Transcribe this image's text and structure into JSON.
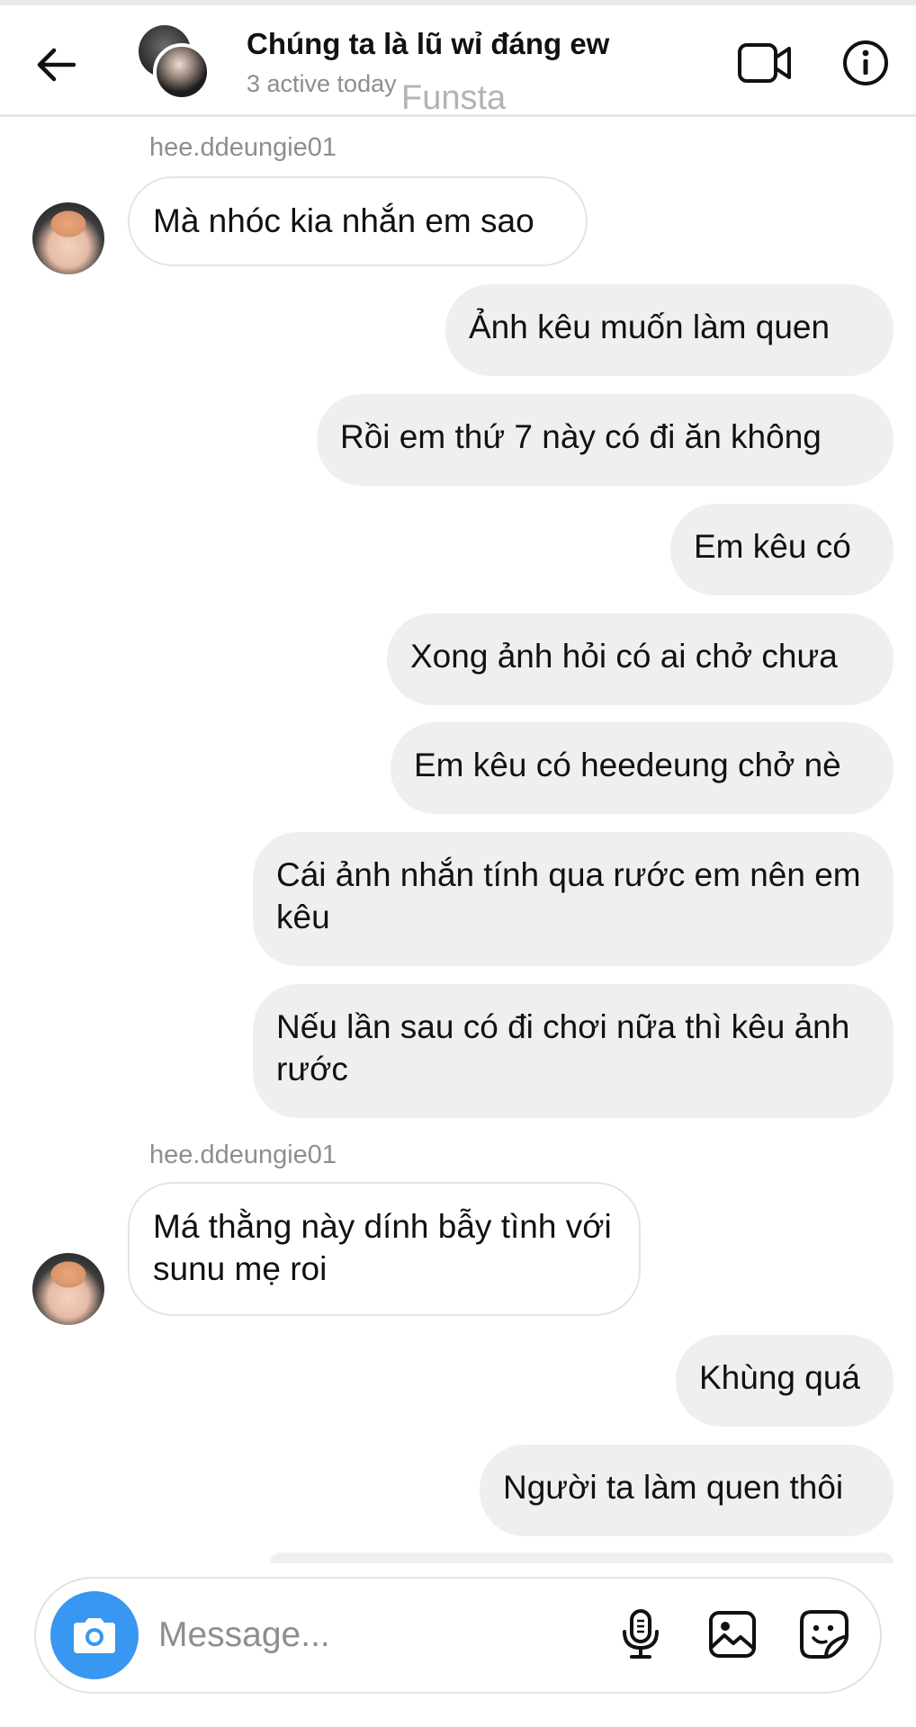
{
  "header": {
    "title": "Chúng ta là lũ wỉ đáng ew",
    "subtitle": "3 active today",
    "watermark": "Funsta"
  },
  "icons": {
    "back": "arrow-left-icon",
    "video": "video-camera-icon",
    "info": "info-icon",
    "camera": "camera-icon",
    "mic": "microphone-icon",
    "gallery": "image-icon",
    "sticker": "sticker-icon"
  },
  "messages": [
    {
      "sender": "hee.ddeungie01",
      "text": "Mà nhóc kia nhắn em sao"
    },
    {
      "text": "Ảnh kêu muốn làm quen"
    },
    {
      "text": "Rồi em thứ 7 này có đi ăn không"
    },
    {
      "text": "Em kêu có"
    },
    {
      "text": "Xong ảnh hỏi có ai chở chưa"
    },
    {
      "text": "Em kêu có heedeung chở nè"
    },
    {
      "text": "Cái ảnh nhắn tính qua rước em nên em kêu"
    },
    {
      "text": "Nếu lần sau có đi chơi nữa thì kêu ảnh rước"
    },
    {
      "sender": "hee.ddeungie01",
      "text": "Má thằng này dính bẫy tình với sunu mẹ roi"
    },
    {
      "text": "Khùng quá"
    },
    {
      "text": "Người ta làm quen thôi"
    }
  ],
  "composer": {
    "placeholder": "Message..."
  },
  "colors": {
    "accent": "#3897f0",
    "bubble_out": "#efefef",
    "bubble_in_border": "#e4e4e4",
    "muted_text": "#8e8e8e"
  }
}
